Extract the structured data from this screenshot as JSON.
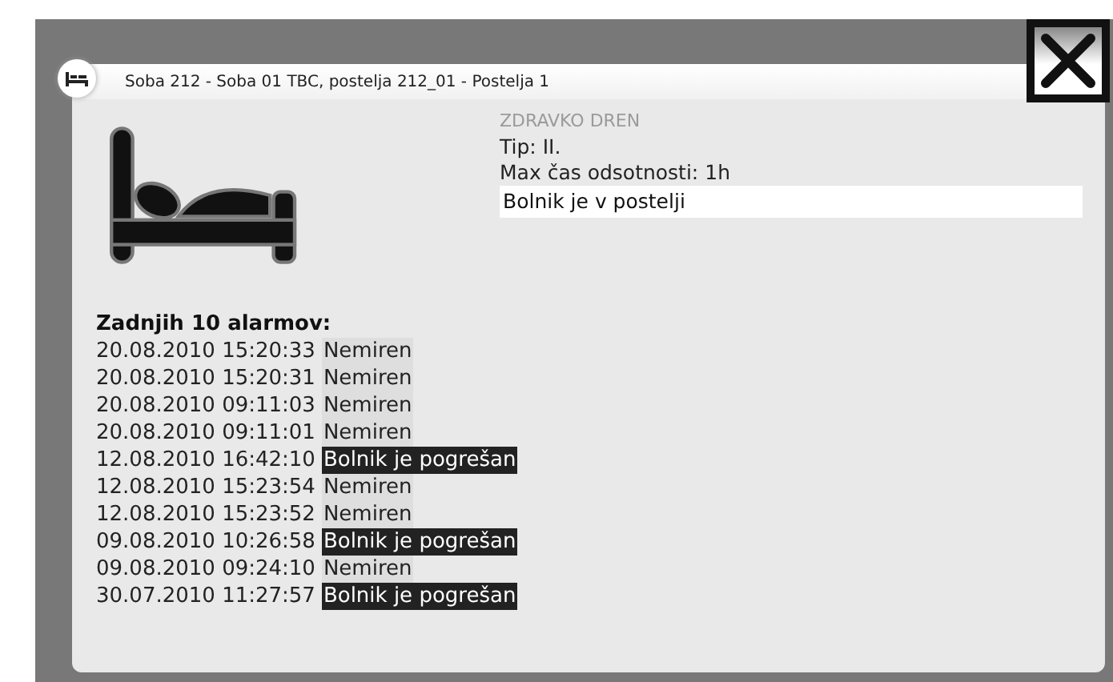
{
  "dialog": {
    "title": "Soba 212 - Soba 01 TBC, postelja 212_01 - Postelja 1"
  },
  "patient": {
    "name": "ZDRAVKO DREN",
    "type": "Tip: II.",
    "max_absence": "Max čas odsotnosti: 1h",
    "status": "Bolnik je v postelji"
  },
  "alarms": {
    "heading": "Zadnjih 10 alarmov:",
    "rows": [
      {
        "time": "20.08.2010 15:20:33",
        "message": "Nemiren",
        "alert": false
      },
      {
        "time": "20.08.2010 15:20:31",
        "message": "Nemiren",
        "alert": false
      },
      {
        "time": "20.08.2010 09:11:03",
        "message": "Nemiren",
        "alert": false
      },
      {
        "time": "20.08.2010 09:11:01",
        "message": "Nemiren",
        "alert": false
      },
      {
        "time": "12.08.2010 16:42:10",
        "message": "Bolnik je pogrešan",
        "alert": true
      },
      {
        "time": "12.08.2010 15:23:54",
        "message": "Nemiren",
        "alert": false
      },
      {
        "time": "12.08.2010 15:23:52",
        "message": "Nemiren",
        "alert": false
      },
      {
        "time": "09.08.2010 10:26:58",
        "message": "Bolnik je pogrešan",
        "alert": true
      },
      {
        "time": "09.08.2010 09:24:10",
        "message": "Nemiren",
        "alert": false
      },
      {
        "time": "30.07.2010 11:27:57",
        "message": "Bolnik je pogrešan",
        "alert": true
      }
    ]
  }
}
